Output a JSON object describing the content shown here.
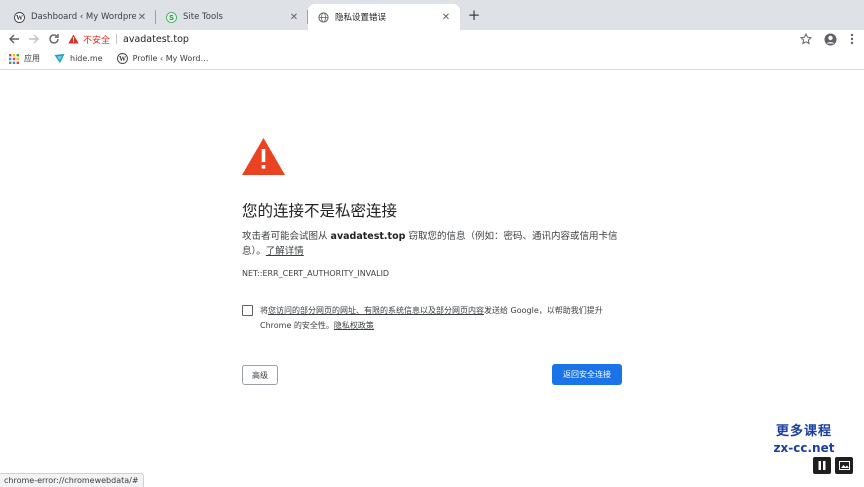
{
  "tabs": [
    {
      "title": "Dashboard ‹ My Wordpress —",
      "favicon": "wordpress-icon",
      "active": false
    },
    {
      "title": "Site Tools",
      "favicon": "site-tools-icon",
      "active": false
    },
    {
      "title": "隐私设置错误",
      "favicon": "globe-icon",
      "active": true
    }
  ],
  "omnibox": {
    "security_label": "不安全",
    "url": "avadatest.top"
  },
  "bookmarks": [
    {
      "label": "应用",
      "icon": "apps-grid-icon"
    },
    {
      "label": "hide.me",
      "icon": "hideme-icon"
    },
    {
      "label": "Profile ‹ My Word…",
      "icon": "wordpress-icon"
    }
  ],
  "interstitial": {
    "heading": "您的连接不是私密连接",
    "body_prefix": "攻击者可能会试图从 ",
    "domain": "avadatest.top",
    "body_suffix": " 窃取您的信息（例如：密码、通讯内容或信用卡信息）。",
    "learn_more": "了解详情",
    "error_code": "NET::ERR_CERT_AUTHORITY_INVALID",
    "consent_prefix": "将",
    "consent_link": "您访问的部分网页的网址、有限的系统信息以及部分网页内容",
    "consent_suffix": "发送给 Google，以帮助我们提升 Chrome 的安全性。",
    "privacy_link": "隐私权政策",
    "advanced_button": "高级",
    "back_button": "返回安全连接"
  },
  "status_bar": "chrome-error://chromewebdata/#",
  "watermark": {
    "line1": "更多课程",
    "line2": "zx-cc.net"
  },
  "colors": {
    "danger": "#d93025",
    "warning_triangle": "#ea4321",
    "primary_button": "#1a73e8"
  }
}
